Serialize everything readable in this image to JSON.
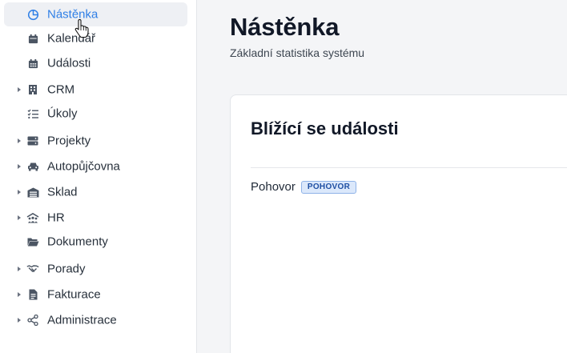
{
  "sidebar": {
    "items": [
      {
        "label": "Nástěnka",
        "icon": "dashboard-pie-icon",
        "active": true,
        "expandable": false
      },
      {
        "label": "Kalendář",
        "icon": "calendar-icon",
        "active": false,
        "expandable": false
      },
      {
        "label": "Události",
        "icon": "calendar-grid-icon",
        "active": false,
        "expandable": false
      },
      {
        "label": "CRM",
        "icon": "building-icon",
        "active": false,
        "expandable": true
      },
      {
        "label": "Úkoly",
        "icon": "checklist-icon",
        "active": false,
        "expandable": false
      },
      {
        "label": "Projekty",
        "icon": "server-icon",
        "active": false,
        "expandable": true
      },
      {
        "label": "Autopůjčovna",
        "icon": "car-icon",
        "active": false,
        "expandable": true
      },
      {
        "label": "Sklad",
        "icon": "warehouse-icon",
        "active": false,
        "expandable": true
      },
      {
        "label": "HR",
        "icon": "people-roof-icon",
        "active": false,
        "expandable": true
      },
      {
        "label": "Dokumenty",
        "icon": "folder-open-icon",
        "active": false,
        "expandable": false
      },
      {
        "label": "Porady",
        "icon": "handshake-icon",
        "active": false,
        "expandable": true
      },
      {
        "label": "Fakturace",
        "icon": "invoice-icon",
        "active": false,
        "expandable": true
      },
      {
        "label": "Administrace",
        "icon": "share-nodes-icon",
        "active": false,
        "expandable": true
      }
    ]
  },
  "main": {
    "title": "Nástěnka",
    "subtitle": "Základní statistika systému",
    "card": {
      "title": "Blížící se události",
      "events": [
        {
          "name": "Pohovor",
          "badge": "POHOVOR"
        }
      ]
    }
  },
  "colors": {
    "accent": "#2f7fe6",
    "active_bg": "#eef0f4",
    "badge_bg": "#dbe8fb",
    "badge_text": "#1e4fa3"
  }
}
